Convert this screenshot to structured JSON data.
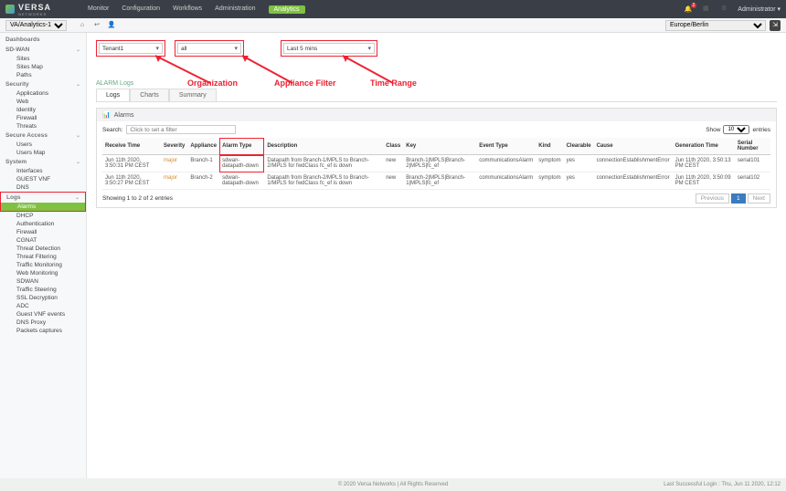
{
  "header": {
    "brand": "VERSA",
    "brand_sub": "NETWORKS",
    "nav": [
      "Monitor",
      "Configuration",
      "Workflows",
      "Administration",
      "Analytics"
    ],
    "active_nav": "Analytics",
    "notif_count": "2",
    "user_label": "Administrator"
  },
  "subbar": {
    "context_select": "VA/Analytics-1",
    "timezone": "Europe/Berlin"
  },
  "sidebar": {
    "dash": "Dashboards",
    "groups": [
      {
        "head": "SD-WAN",
        "items": [
          "Sites",
          "Sites Map",
          "Paths"
        ]
      },
      {
        "head": "Security",
        "items": [
          "Applications",
          "Web",
          "Identity",
          "Firewall",
          "Threats"
        ]
      },
      {
        "head": "Secure Access",
        "items": [
          "Users",
          "Users Map"
        ]
      },
      {
        "head": "System",
        "items": [
          "Interfaces",
          "GUEST VNF",
          "DNS"
        ]
      }
    ],
    "logs_head": "Logs",
    "logs_items": [
      "Alarms",
      "DHCP",
      "Authentication",
      "Firewall",
      "CGNAT",
      "Threat Detection",
      "Threat Filtering",
      "Traffic Monitoring",
      "Web Monitoring",
      "SDWAN",
      "Traffic Steering",
      "SSL Decryption",
      "ADC",
      "Guest VNF events",
      "DNS Proxy",
      "Packets captures"
    ],
    "active": "Alarms"
  },
  "filters": {
    "org": "Tenant1",
    "appliance": "all",
    "range": "Last 5 mins"
  },
  "annotations": {
    "org": "Organization",
    "app": "Appliance Filter",
    "time": "Time Range"
  },
  "section": "ALARM Logs",
  "tabs": [
    "Logs",
    "Charts",
    "Summary"
  ],
  "panel_title": "Alarms",
  "search_label": "Search:",
  "search_placeholder": "Click to set a filter",
  "show_label": "Show",
  "entries_label": "entries",
  "columns": [
    "Receive Time",
    "Severity",
    "Appliance",
    "Alarm Type",
    "Description",
    "Class",
    "Key",
    "Event Type",
    "Kind",
    "Clearable",
    "Cause",
    "Generation Time",
    "Serial Number"
  ],
  "rows": [
    {
      "time": "Jun 11th 2020, 3:50:31 PM CEST",
      "sev": "major",
      "app": "Branch-1",
      "type": "sdwan-datapath-down",
      "desc": "Datapath from Branch-1/MPLS to Branch-2/MPLS for fwdClass fc_ef is down",
      "class": "new",
      "key": "Branch-1|MPLS|Branch-2|MPLS|fc_ef",
      "evt": "communicationsAlarm",
      "kind": "symptom",
      "clr": "yes",
      "cause": "connectionEstablishmentError",
      "gen": "Jun 11th 2020, 3:50:13 PM CEST",
      "sn": "serial101"
    },
    {
      "time": "Jun 11th 2020, 3:50:27 PM CEST",
      "sev": "major",
      "app": "Branch-2",
      "type": "sdwan-datapath-down",
      "desc": "Datapath from Branch-2/MPLS to Branch-1/MPLS for fwdClass fc_ef is down",
      "class": "new",
      "key": "Branch-2|MPLS|Branch-1|MPLS|fc_ef",
      "evt": "communicationsAlarm",
      "kind": "symptom",
      "clr": "yes",
      "cause": "connectionEstablishmentError",
      "gen": "Jun 11th 2020, 3:50:09 PM CEST",
      "sn": "serial102"
    }
  ],
  "pager": {
    "summary": "Showing 1 to 2 of 2 entries",
    "prev": "Previous",
    "page": "1",
    "next": "Next"
  },
  "footer": {
    "copy": "© 2020 Versa Networks | All Rights Reserved",
    "login": "Last Successful Login : Thu, Jun 11 2020, 12:12"
  }
}
